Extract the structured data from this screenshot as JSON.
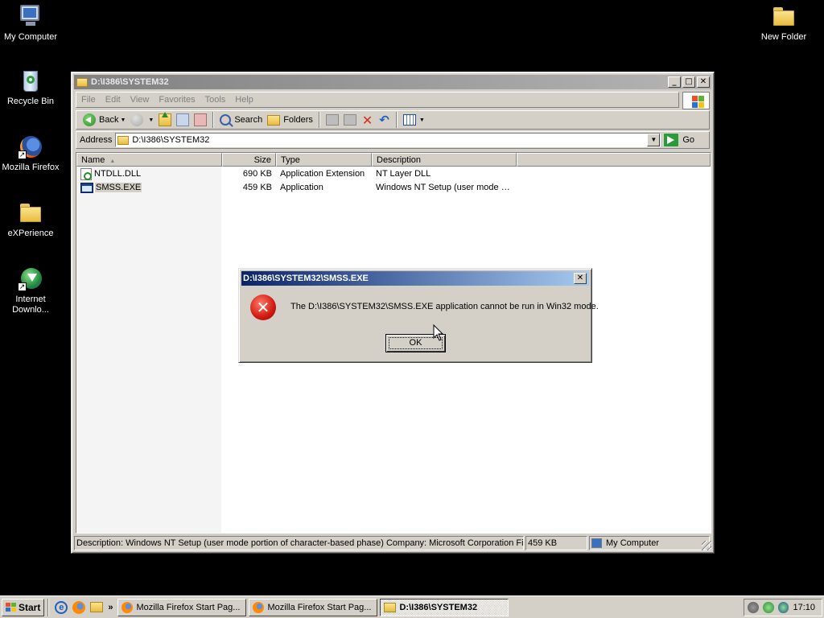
{
  "desktop": {
    "icons": [
      {
        "label": "My Computer"
      },
      {
        "label": "Recycle Bin"
      },
      {
        "label": "Mozilla Firefox"
      },
      {
        "label": "eXPerience"
      },
      {
        "label": "Internet Downlo..."
      },
      {
        "label": "New Folder"
      }
    ]
  },
  "explorer": {
    "title": "D:\\I386\\SYSTEM32",
    "menu": [
      "File",
      "Edit",
      "View",
      "Favorites",
      "Tools",
      "Help"
    ],
    "toolbar": {
      "back_label": "Back",
      "search_label": "Search",
      "folders_label": "Folders"
    },
    "address": {
      "label": "Address",
      "value": "D:\\I386\\SYSTEM32",
      "go_label": "Go"
    },
    "columns": [
      "Name",
      "Size",
      "Type",
      "Description"
    ],
    "files": [
      {
        "name": "NTDLL.DLL",
        "size": "690 KB",
        "type": "Application Extension",
        "description": "NT Layer DLL"
      },
      {
        "name": "SMSS.EXE",
        "size": "459 KB",
        "type": "Application",
        "description": "Windows NT Setup (user mode p..."
      }
    ],
    "status": {
      "description": "Description: Windows NT Setup (user mode portion of character-based phase) Company: Microsoft Corporation File",
      "size": "459 KB",
      "location": "My Computer"
    }
  },
  "dialog": {
    "title": "D:\\I386\\SYSTEM32\\SMSS.EXE",
    "message": "The D:\\I386\\SYSTEM32\\SMSS.EXE application cannot be run in Win32 mode.",
    "ok_label": "OK",
    "close_glyph": "✕"
  },
  "taskbar": {
    "start_label": "Start",
    "more_glyph": "»",
    "tasks": [
      {
        "label": "Mozilla Firefox Start Pag..."
      },
      {
        "label": "Mozilla Firefox Start Pag..."
      },
      {
        "label": "D:\\I386\\SYSTEM32"
      }
    ],
    "clock": "17:10"
  },
  "colors": {
    "desktop_bg": "#000000",
    "active_title_start": "#0a246a",
    "active_title_end": "#a6caf0",
    "inactive_title": "#808080",
    "face": "#d4d0c8"
  }
}
